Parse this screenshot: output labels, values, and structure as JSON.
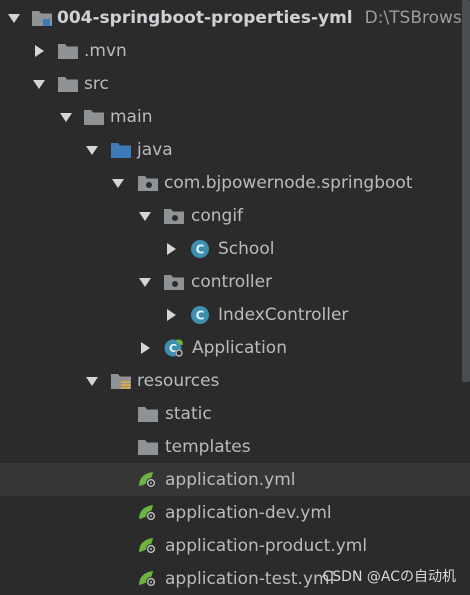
{
  "project": {
    "name": "004-springboot-properties-yml",
    "path": "D:\\TSBrowser\\"
  },
  "tree": {
    "mvn": ".mvn",
    "src": "src",
    "main": "main",
    "java": "java",
    "package": "com.bjpowernode.springboot",
    "congif": "congif",
    "school": "School",
    "controller": "controller",
    "index_controller": "IndexController",
    "application": "Application",
    "resources": "resources",
    "static": "static",
    "templates": "templates",
    "application_yml": "application.yml",
    "application_dev_yml": "application-dev.yml",
    "application_product_yml": "application-product.yml",
    "application_test_yml": "application-test.yml"
  },
  "icons": {
    "folder_color": "#8f9396",
    "source_folder_color": "#3d7ab8",
    "class_color": "#3d8fb0",
    "spring_color": "#6db33f"
  },
  "watermark": "CSDN @ACの自动机"
}
